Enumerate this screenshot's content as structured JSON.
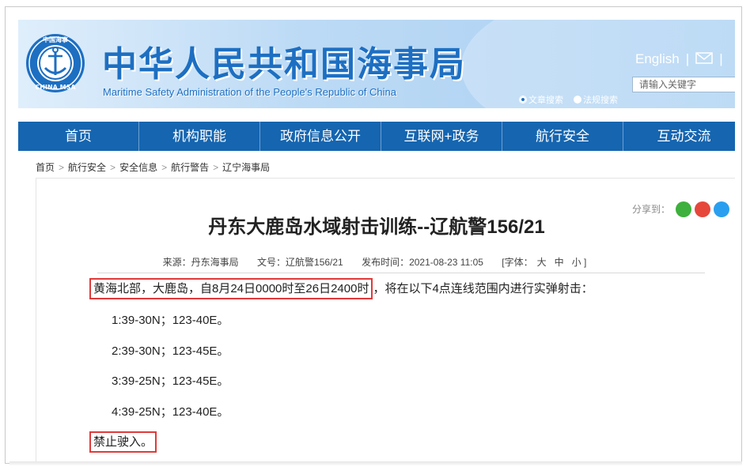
{
  "header": {
    "cn_title": "中华人民共和国海事局",
    "en_title": "Maritime Safety Administration of the People's Republic of China",
    "logo_top_text": "中国海事",
    "logo_bottom_text": "CHINA MSA",
    "lang_link": "English",
    "sep": "|",
    "radio_1": "文章搜索",
    "radio_2": "法规搜索",
    "search_placeholder": "请输入关键字"
  },
  "nav": [
    "首页",
    "机构职能",
    "政府信息公开",
    "互联网+政务",
    "航行安全",
    "互动交流"
  ],
  "breadcrumb": [
    "首页",
    "航行安全",
    "安全信息",
    "航行警告",
    "辽宁海事局"
  ],
  "breadcrumb_sep": ">",
  "share_label": "分享到：",
  "article": {
    "title": "丹东大鹿岛水域射击训练--辽航警156/21",
    "source": "来源：丹东海事局",
    "doc_no": "文号：辽航警156/21",
    "published": "发布时间：2021-08-23 11:05",
    "font_label": "[字体：",
    "font_large": "大",
    "font_mid": "中",
    "font_small": "小 ]",
    "intro_highlight": "黄海北部，大鹿岛，自8月24日0000时至26日2400时",
    "intro_rest": "，将在以下4点连线范围内进行实弹射击：",
    "points": [
      "1:39-30N；123-40E。",
      "2:39-30N；123-45E。",
      "3:39-25N；123-45E。",
      "4:39-25N；123-40E。"
    ],
    "closing": "禁止驶入。"
  },
  "colors": {
    "nav_bg": "#1565b0",
    "title_blue": "#1d6fc2",
    "highlight": "#e03a3a"
  }
}
